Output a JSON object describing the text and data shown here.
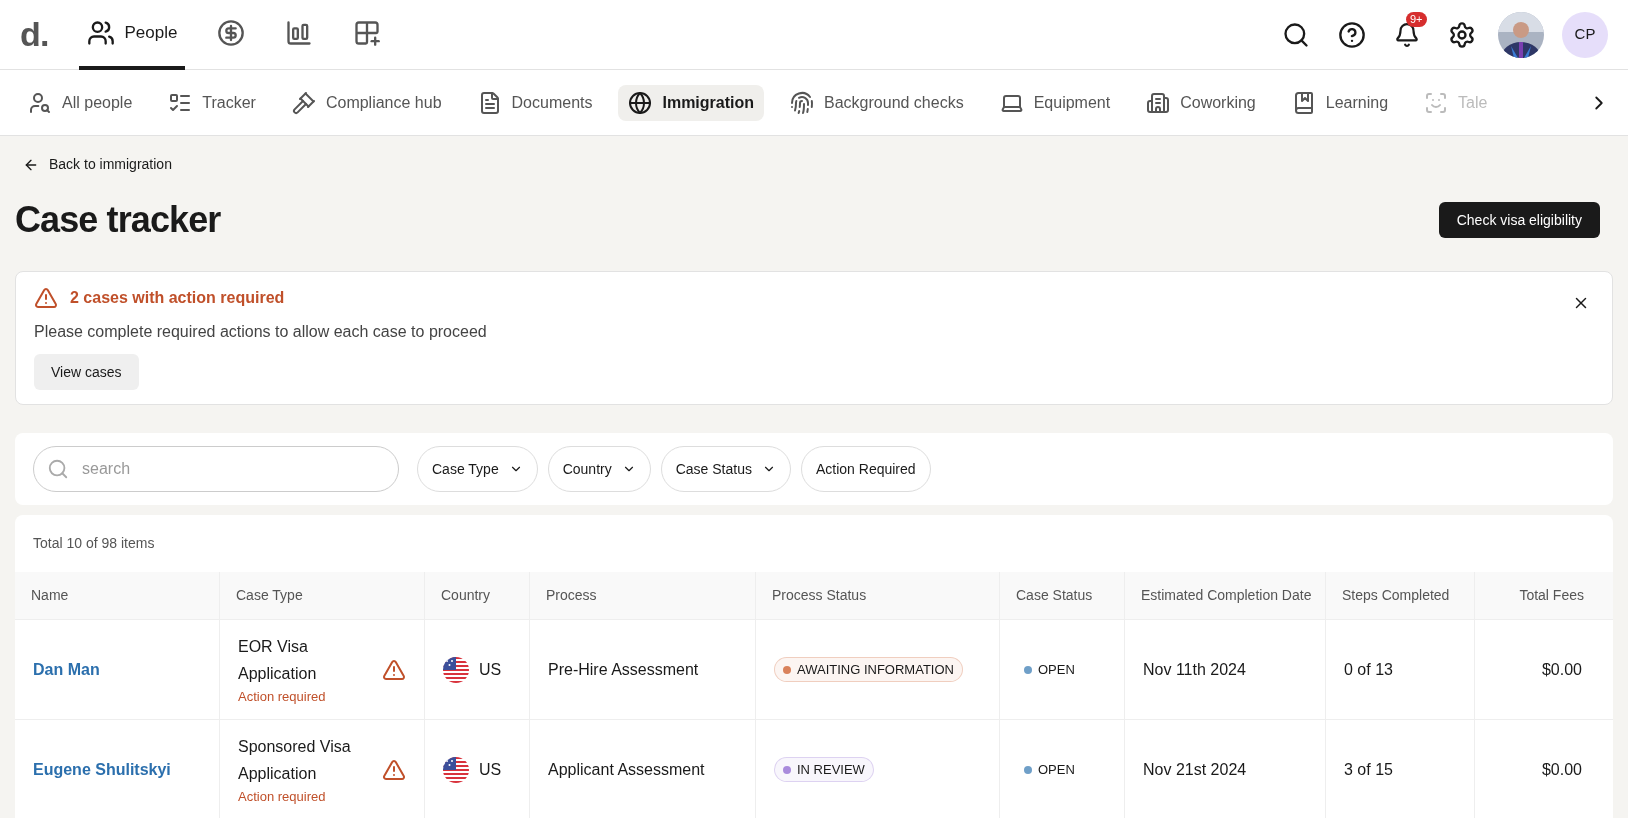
{
  "logo": "d.",
  "main_nav": [
    {
      "label": "People",
      "selected": true
    },
    {
      "selected": false
    },
    {
      "selected": false
    },
    {
      "selected": false
    }
  ],
  "header_actions": {
    "notification_badge": "9+",
    "avatar_initials": "CP"
  },
  "sub_nav": [
    {
      "label": "All people",
      "selected": false
    },
    {
      "label": "Tracker",
      "selected": false
    },
    {
      "label": "Compliance hub",
      "selected": false
    },
    {
      "label": "Documents",
      "selected": false
    },
    {
      "label": "Immigration",
      "selected": true
    },
    {
      "label": "Background checks",
      "selected": false
    },
    {
      "label": "Equipment",
      "selected": false
    },
    {
      "label": "Coworking",
      "selected": false
    },
    {
      "label": "Learning",
      "selected": false
    },
    {
      "label": "Tale",
      "selected": false
    }
  ],
  "back_link": "Back to immigration",
  "page_title": "Case tracker",
  "primary_button": "Check visa eligibility",
  "alert": {
    "title": "2 cases with action required",
    "message": "Please complete required actions to allow each case to proceed",
    "button": "View cases"
  },
  "search": {
    "placeholder": "search"
  },
  "filters": [
    {
      "label": "Case Type",
      "kind": "dropdown"
    },
    {
      "label": "Country",
      "kind": "dropdown"
    },
    {
      "label": "Case Status",
      "kind": "dropdown"
    },
    {
      "label": "Action Required",
      "kind": "toggle"
    }
  ],
  "table": {
    "total": "Total 10 of 98 items",
    "columns": [
      "Name",
      "Case Type",
      "Country",
      "Process",
      "Process Status",
      "Case Status",
      "Estimated Completion Date",
      "Steps Completed",
      "Total Fees"
    ],
    "rows": [
      {
        "name": "Dan Man",
        "case_type": "EOR Visa Application",
        "action": "Action required",
        "country": "US",
        "process": "Pre-Hire Assessment",
        "process_status": {
          "label": "AWAITING INFORMATION",
          "color": "#d9825b"
        },
        "case_status": {
          "label": "OPEN",
          "color": "#6f9fc8"
        },
        "date": "Nov 11th 2024",
        "steps": "0 of 13",
        "fees": "$0.00"
      },
      {
        "name": "Eugene Shulitskyi",
        "case_type": "Sponsored Visa Application",
        "action": "Action required",
        "country": "US",
        "process": "Applicant Assessment",
        "process_status": {
          "label": "IN REVIEW",
          "color": "#a98bdc"
        },
        "case_status": {
          "label": "OPEN",
          "color": "#6f9fc8"
        },
        "date": "Nov 21st 2024",
        "steps": "3 of 15",
        "fees": "$0.00"
      }
    ]
  }
}
